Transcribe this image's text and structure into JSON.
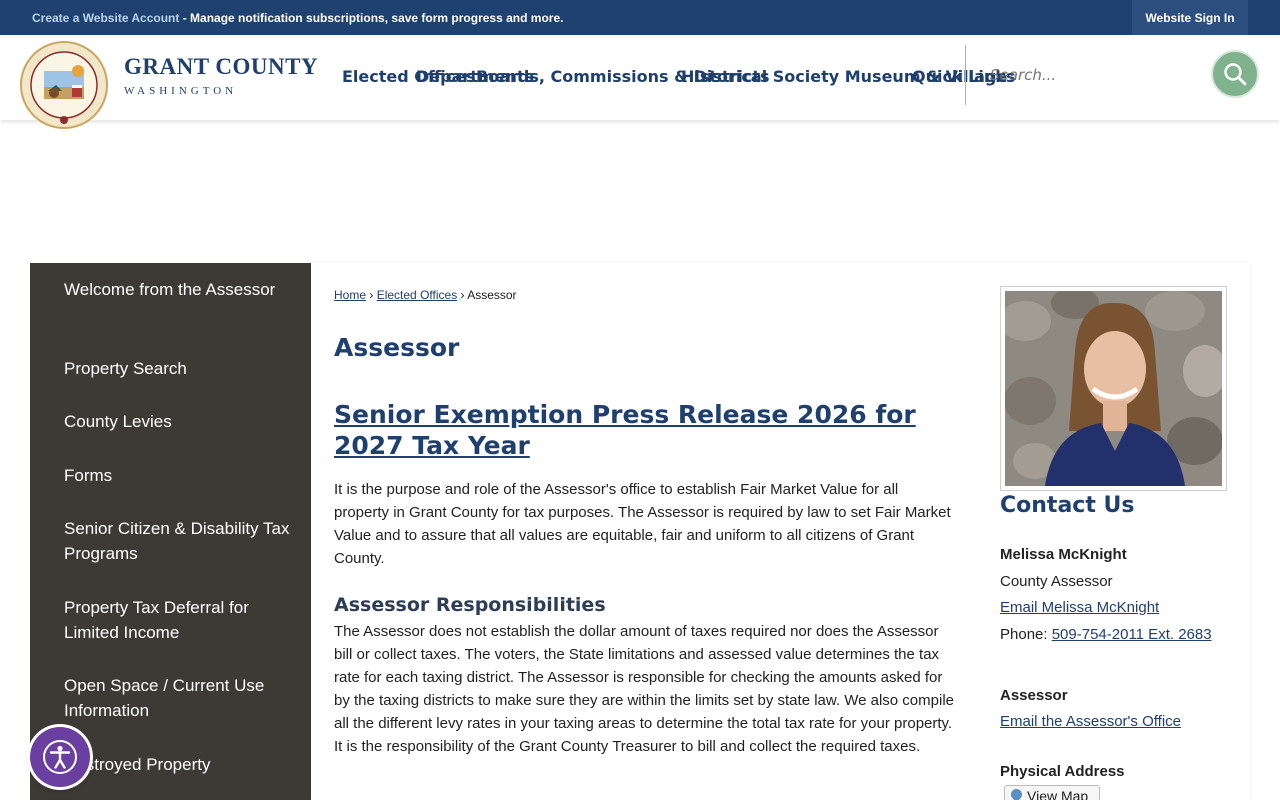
{
  "topbar": {
    "account_link": "Create a Website Account",
    "account_text": " - Manage notification subscriptions, save form progress and more.",
    "sign_in": "Website Sign In"
  },
  "header": {
    "brand_name": "GRANT COUNTY",
    "brand_sub": "WASHINGTON",
    "nav": [
      "Elected Offices",
      "Departments",
      "Boards, Commissions & Districts",
      "Historical Society Museum & Village",
      "Quick Links"
    ],
    "search_placeholder": "Search...",
    "colors": {
      "bar": "#1f4170",
      "brand": "#1f3f6e",
      "search_button": "#7fb28d"
    }
  },
  "sidebar": {
    "items": [
      "Welcome from the Assessor",
      "Property Search",
      "County Levies",
      "Forms",
      "Senior Citizen & Disability Tax Programs",
      "Property Tax Deferral for Limited Income",
      "Open Space / Current Use Information",
      "Destroyed Property"
    ]
  },
  "breadcrumb": {
    "home": "Home",
    "sep": "›",
    "parent": "Elected Offices",
    "current": "Assessor"
  },
  "main": {
    "title": "Assessor",
    "news_link": "Senior Exemption Press Release 2026 for 2027 Tax Year",
    "intro": "It is the purpose and role of the Assessor's office to establish Fair Market Value for all property in Grant County for tax purposes. The Assessor is required by law to set Fair Market Value and to assure that all values are equitable, fair and uniform to all citizens of Grant County.",
    "responsibilities_heading": "Assessor Responsibilities",
    "responsibilities_text": "The Assessor does not establish the dollar amount of taxes required nor does the Assessor bill or collect taxes. The voters, the State limitations and assessed value determines the tax rate for each taxing district. The Assessor is responsible for checking the amounts asked for by the taxing districts to make sure they are within the limits set by state law. We also compile all the different levy rates in your taxing areas to determine the total tax rate for your property. It is the responsibility of the Grant County Treasurer to bill and collect the required taxes."
  },
  "contact": {
    "heading": "Contact Us",
    "name": "Melissa McKnight",
    "role": "County Assessor",
    "email_person": "Email Melissa McKnight",
    "phone_label": "Phone: ",
    "phone": "509-754-2011 Ext. 2683",
    "office_label": "Assessor",
    "email_office": "Email the Assessor's Office",
    "address_label": "Physical Address",
    "view_map": "View Map"
  }
}
